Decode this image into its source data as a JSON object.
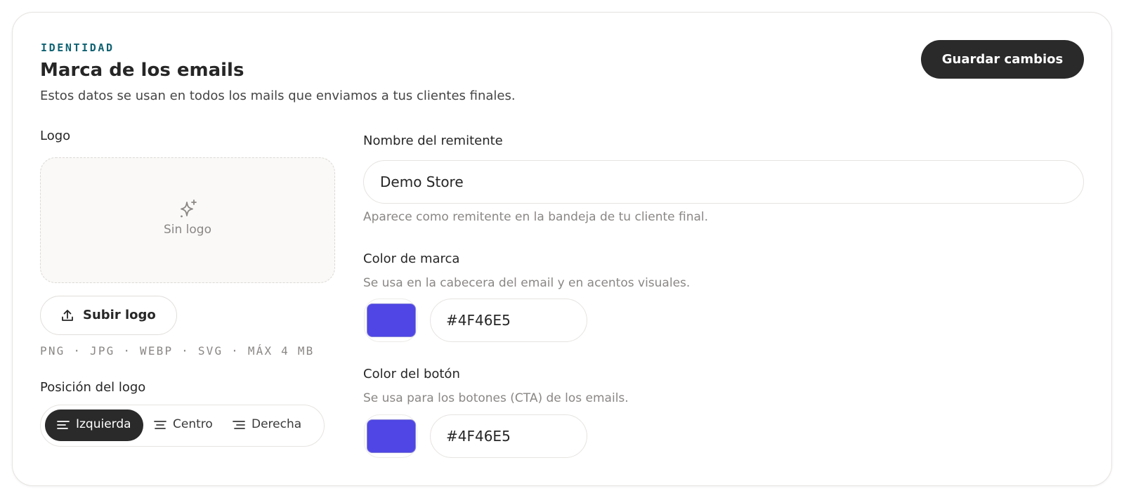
{
  "header": {
    "eyebrow": "IDENTIDAD",
    "title": "Marca de los emails",
    "subtitle": "Estos datos se usan en todos los mails que enviamos a tus clientes finales.",
    "save_label": "Guardar cambios"
  },
  "logo": {
    "label": "Logo",
    "empty_text": "Sin logo",
    "upload_label": "Subir logo",
    "formats": "PNG · JPG · WEBP · SVG · MÁX 4 MB",
    "position_label": "Posición del logo",
    "position_options": [
      "Izquierda",
      "Centro",
      "Derecha"
    ],
    "position_selected": "Izquierda"
  },
  "sender": {
    "label": "Nombre del remitente",
    "value": "Demo Store",
    "help": "Aparece como remitente en la bandeja de tu cliente final."
  },
  "brand_color": {
    "label": "Color de marca",
    "help": "Se usa en la cabecera del email y en acentos visuales.",
    "value": "#4F46E5"
  },
  "button_color": {
    "label": "Color del botón",
    "help": "Se usa para los botones (CTA) de los emails.",
    "value": "#4F46E5"
  },
  "colors": {
    "accent_text": "#0f6272",
    "primary_button": "#2a2a2a",
    "swatch": "#4F46E5"
  },
  "icons": {
    "empty_logo": "sparkle-icon",
    "upload": "upload-icon",
    "align_left": "align-left-icon",
    "align_center": "align-center-icon",
    "align_right": "align-right-icon"
  }
}
